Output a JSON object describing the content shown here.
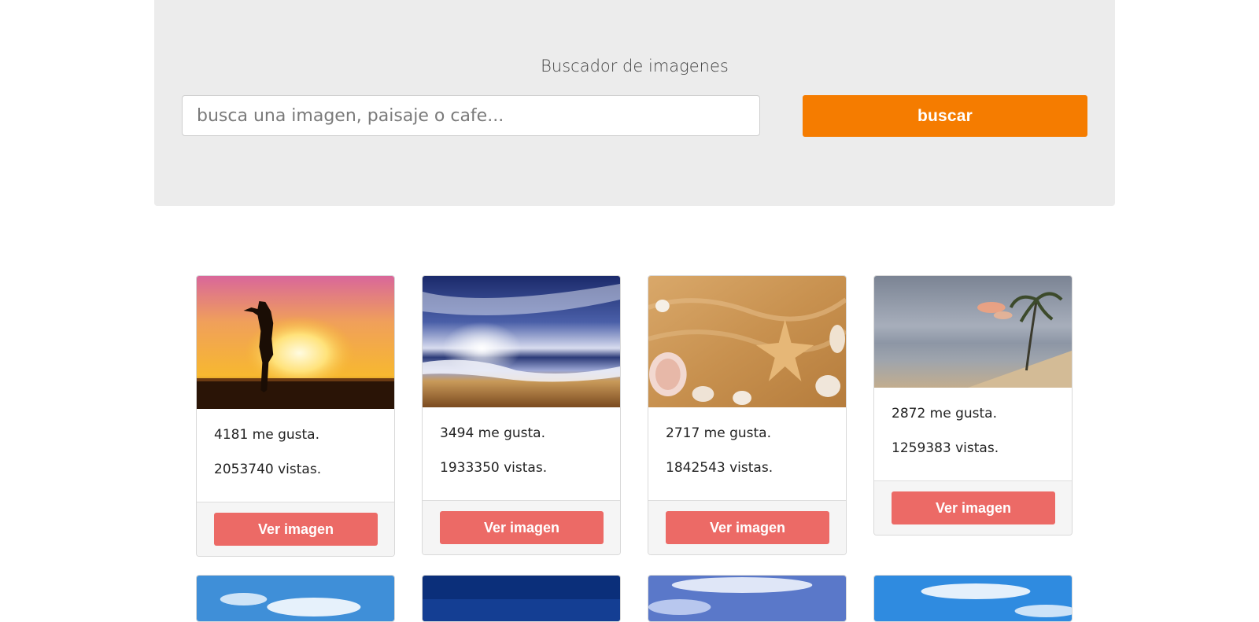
{
  "header": {
    "title": "Buscador de imagenes",
    "search_placeholder": "busca una imagen, paisaje o cafe...",
    "search_value": "",
    "search_button": "buscar"
  },
  "colors": {
    "jumbotron_bg": "#ececec",
    "search_button": "#f57c00",
    "view_button": "#ec6a66",
    "card_footer": "#f5f5f5"
  },
  "results": [
    {
      "likes_text": "4181 me gusta.",
      "views_text": "2053740 vistas.",
      "button": "Ver imagen",
      "image": "woman-silhouette-sunset-beach"
    },
    {
      "likes_text": "3494 me gusta.",
      "views_text": "1933350 vistas.",
      "button": "Ver imagen",
      "image": "sunset-ocean-waves-beach"
    },
    {
      "likes_text": "2717 me gusta.",
      "views_text": "1842543 vistas.",
      "button": "Ver imagen",
      "image": "seashells-starfish-sand"
    },
    {
      "likes_text": "2872 me gusta.",
      "views_text": "1259383 vistas.",
      "button": "Ver imagen",
      "image": "palm-tree-beach-cloudy-sky"
    }
  ],
  "next_row_images": [
    "blue-sky-clouds",
    "dark-blue-sky",
    "blue-sky-clouds",
    "blue-sky-clouds"
  ]
}
